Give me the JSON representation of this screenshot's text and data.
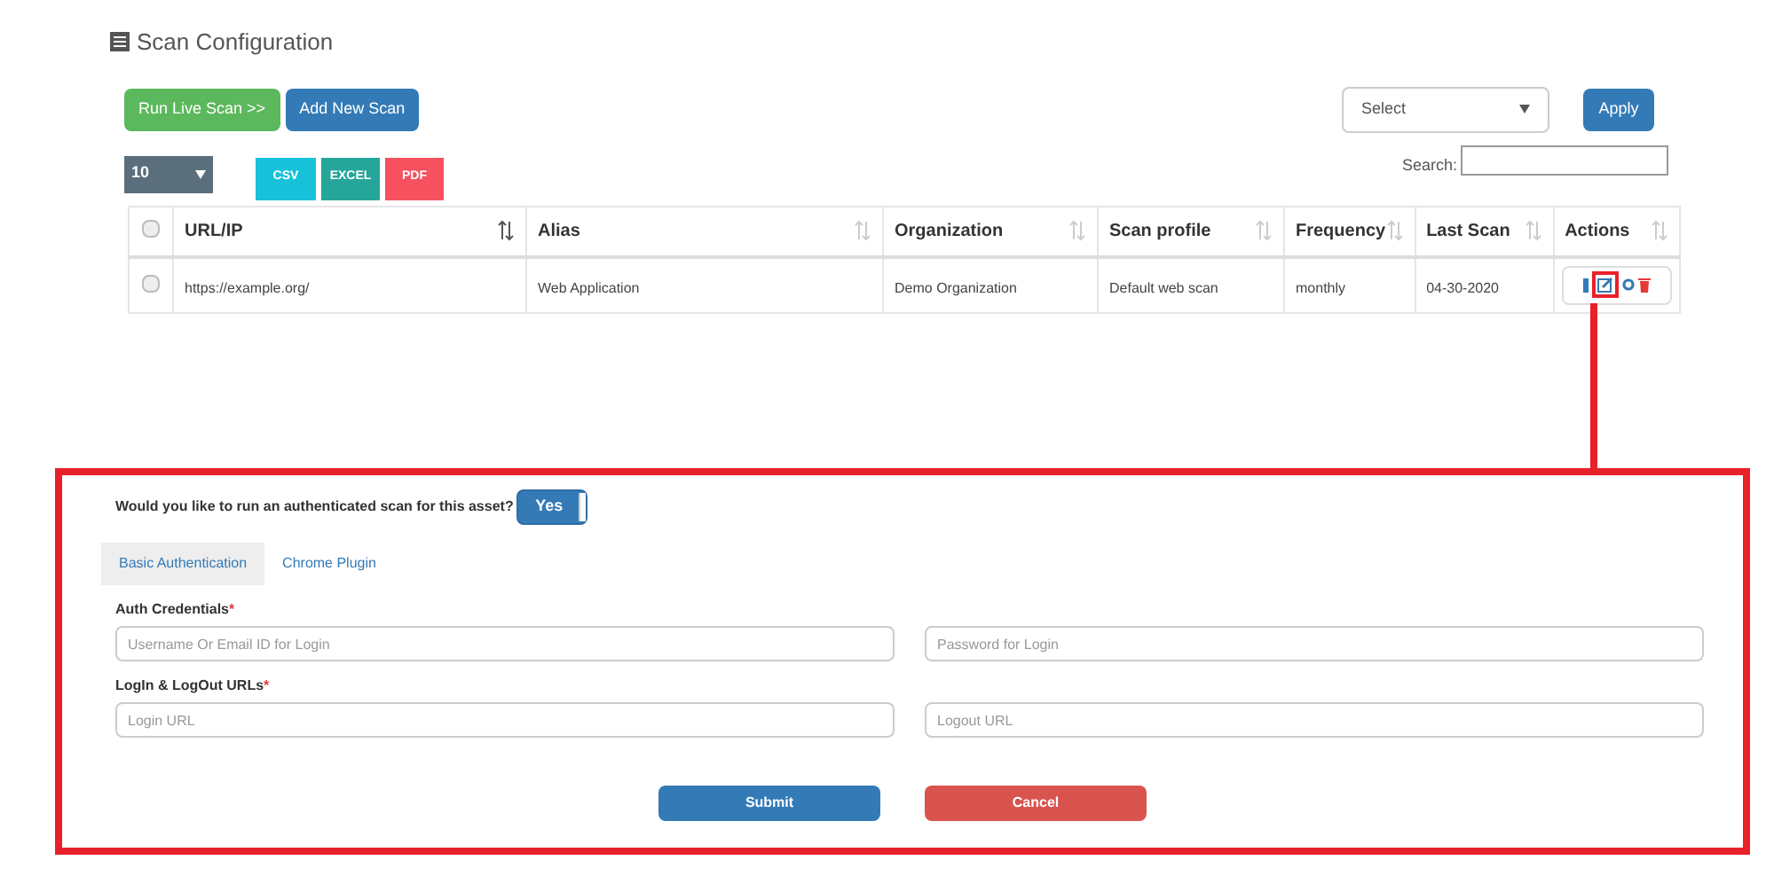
{
  "page": {
    "title": "Scan Configuration"
  },
  "toolbar": {
    "buttons": [
      {
        "label": "Run Live Scan >>",
        "kind": "success"
      },
      {
        "label": "Add New Scan",
        "kind": "primary"
      }
    ],
    "bulk_select": {
      "value": "Select"
    },
    "apply": "Apply"
  },
  "table_controls": {
    "page_size": "10",
    "exports": [
      {
        "label": "CSV",
        "kind": "csv"
      },
      {
        "label": "EXCEL",
        "kind": "excel"
      },
      {
        "label": "PDF",
        "kind": "pdf"
      }
    ],
    "search_label": "Search:"
  },
  "table": {
    "select_all": {
      "checked": false
    },
    "columns": [
      {
        "label": "URL/IP",
        "sorted": true
      },
      {
        "label": "Alias",
        "sorted": false
      },
      {
        "label": "Organization",
        "sorted": false
      },
      {
        "label": "Scan profile",
        "sorted": false
      },
      {
        "label": "Frequency",
        "sorted": false
      },
      {
        "label": "Last Scan",
        "sorted": false
      },
      {
        "label": "Actions",
        "sorted": false
      }
    ],
    "rows": [
      {
        "checked": false,
        "cells": [
          "https://example.org/",
          "Web Application",
          "Demo Organization",
          "Default web scan",
          "monthly",
          "04-30-2020"
        ],
        "edit_highlighted": true
      }
    ]
  },
  "auth_panel": {
    "question": "Would you like to run an authenticated scan for this asset?",
    "toggle": {
      "label": "Yes",
      "on": true
    },
    "tabs": [
      {
        "label": "Basic Authentication",
        "selected": true
      },
      {
        "label": "Chrome Plugin",
        "selected": false
      }
    ],
    "groups": [
      {
        "label": "Auth Credentials",
        "required": "*",
        "fields": [
          {
            "placeholder": "Username Or Email ID for Login"
          },
          {
            "placeholder": "Password for Login"
          }
        ]
      },
      {
        "label": "LogIn & LogOut URLs",
        "required": "*",
        "fields": [
          {
            "placeholder": "Login URL"
          },
          {
            "placeholder": "Logout URL"
          }
        ]
      }
    ],
    "buttons": [
      {
        "label": "Submit",
        "kind": "primary"
      },
      {
        "label": "Cancel",
        "kind": "danger"
      }
    ]
  }
}
